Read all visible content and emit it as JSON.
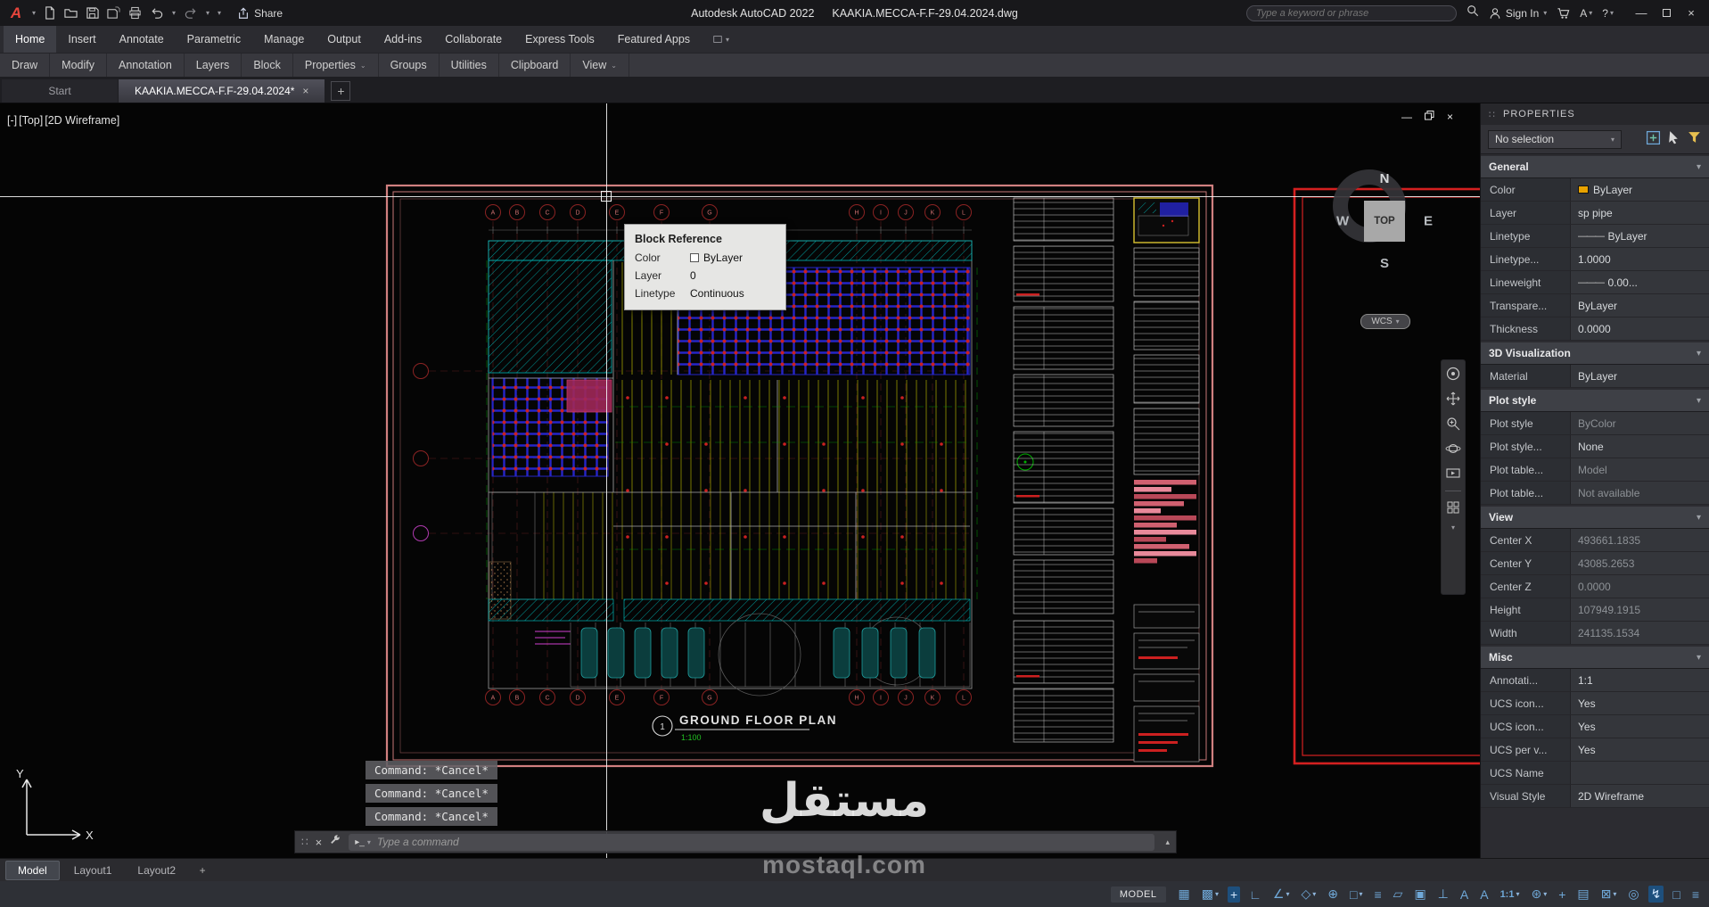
{
  "titlebar": {
    "app_name": "Autodesk AutoCAD 2022",
    "doc_name": "KAAKIA.MECCA-F.F-29.04.2024.dwg",
    "share": "Share",
    "search_placeholder": "Type a keyword or phrase",
    "sign_in": "Sign In",
    "help": "?",
    "alerts": "A"
  },
  "ribbon": {
    "tabs": [
      "Home",
      "Insert",
      "Annotate",
      "Parametric",
      "Manage",
      "Output",
      "Add-ins",
      "Collaborate",
      "Express Tools",
      "Featured Apps"
    ],
    "active_tab": "Home",
    "panels": [
      {
        "label": "Draw"
      },
      {
        "label": "Modify"
      },
      {
        "label": "Annotation"
      },
      {
        "label": "Layers"
      },
      {
        "label": "Block"
      },
      {
        "label": "Properties",
        "caret": true
      },
      {
        "label": "Groups"
      },
      {
        "label": "Utilities"
      },
      {
        "label": "Clipboard"
      },
      {
        "label": "View",
        "caret": true
      }
    ]
  },
  "file_tabs": {
    "tabs": [
      {
        "label": "Start",
        "active": false,
        "closable": false
      },
      {
        "label": "KAAKIA.MECCA-F.F-29.04.2024*",
        "active": true,
        "closable": true
      }
    ]
  },
  "viewport": {
    "controls": [
      "[-]",
      "[Top]",
      "[2D Wireframe]"
    ],
    "compass": {
      "n": "N",
      "s": "S",
      "e": "E",
      "w": "W",
      "center": "TOP",
      "ucs": "WCS"
    }
  },
  "tooltip": {
    "title": "Block Reference",
    "rows": [
      {
        "label": "Color",
        "value": "ByLayer",
        "swatch": true
      },
      {
        "label": "Layer",
        "value": "0"
      },
      {
        "label": "Linetype",
        "value": "Continuous"
      }
    ]
  },
  "command": {
    "history": [
      "Command: *Cancel*",
      "Command: *Cancel*",
      "Command: *Cancel*"
    ],
    "placeholder": "Type a command"
  },
  "drawing": {
    "title": "GROUND FLOOR PLAN",
    "scale": "1:100",
    "detail": "1",
    "grid_labels": [
      "A",
      "B",
      "C",
      "D",
      "E",
      "F",
      "G",
      "H",
      "I",
      "J",
      "K",
      "L"
    ]
  },
  "properties": {
    "title": "PROPERTIES",
    "selection": "No selection",
    "sections": [
      {
        "title": "General",
        "rows": [
          {
            "label": "Color",
            "value": "ByLayer",
            "swatch": "#e8a200"
          },
          {
            "label": "Layer",
            "value": "sp pipe"
          },
          {
            "label": "Linetype",
            "value": "ByLayer",
            "line": true
          },
          {
            "label": "Linetype...",
            "value": "1.0000"
          },
          {
            "label": "Lineweight",
            "value": "0.00...",
            "line": true
          },
          {
            "label": "Transpare...",
            "value": "ByLayer"
          },
          {
            "label": "Thickness",
            "value": "0.0000"
          }
        ]
      },
      {
        "title": "3D Visualization",
        "rows": [
          {
            "label": "Material",
            "value": "ByLayer"
          }
        ]
      },
      {
        "title": "Plot style",
        "rows": [
          {
            "label": "Plot style",
            "value": "ByColor",
            "dim": true
          },
          {
            "label": "Plot style...",
            "value": "None"
          },
          {
            "label": "Plot table...",
            "value": "Model",
            "dim": true
          },
          {
            "label": "Plot table...",
            "value": "Not available",
            "dim": true
          }
        ]
      },
      {
        "title": "View",
        "rows": [
          {
            "label": "Center X",
            "value": "493661.1835",
            "dim": true
          },
          {
            "label": "Center Y",
            "value": "43085.2653",
            "dim": true
          },
          {
            "label": "Center Z",
            "value": "0.0000",
            "dim": true
          },
          {
            "label": "Height",
            "value": "107949.1915",
            "dim": true
          },
          {
            "label": "Width",
            "value": "241135.1534",
            "dim": true
          }
        ]
      },
      {
        "title": "Misc",
        "rows": [
          {
            "label": "Annotati...",
            "value": "1:1"
          },
          {
            "label": "UCS icon...",
            "value": "Yes"
          },
          {
            "label": "UCS icon...",
            "value": "Yes"
          },
          {
            "label": "UCS per v...",
            "value": "Yes"
          },
          {
            "label": "UCS Name",
            "value": ""
          },
          {
            "label": "Visual Style",
            "value": "2D Wireframe"
          }
        ]
      }
    ]
  },
  "layout_tabs": {
    "tabs": [
      "Model",
      "Layout1",
      "Layout2"
    ],
    "active": "Model"
  },
  "statusbar": {
    "model": "MODEL",
    "icons": [
      {
        "name": "grid-display",
        "glyph": "▦"
      },
      {
        "name": "snap-mode",
        "glyph": "▩",
        "caret": true
      },
      {
        "name": "dynamic-input",
        "glyph": "+",
        "active": true
      },
      {
        "name": "ortho-mode",
        "glyph": "∟"
      },
      {
        "name": "polar-tracking",
        "glyph": "∠",
        "caret": true
      },
      {
        "name": "isometric-drafting",
        "glyph": "◇",
        "caret": true
      },
      {
        "name": "object-snap-tracking",
        "glyph": "⊕"
      },
      {
        "name": "object-snap",
        "glyph": "□",
        "caret": true
      },
      {
        "name": "lineweight",
        "glyph": "≡"
      },
      {
        "name": "transparency",
        "glyph": "▱"
      },
      {
        "name": "selection-cycling",
        "glyph": "▣"
      },
      {
        "name": "dynamic-ucs",
        "glyph": "⊥"
      },
      {
        "name": "annotation-visibility",
        "glyph": "A"
      },
      {
        "name": "autoscale",
        "glyph": "A"
      },
      {
        "name": "annotation-scale",
        "glyph": "1:1",
        "caret": true,
        "text": true
      },
      {
        "name": "workspace-switching",
        "glyph": "⊛",
        "caret": true
      },
      {
        "name": "annotation-monitor",
        "glyph": "+"
      },
      {
        "name": "quick-properties",
        "glyph": "▤"
      },
      {
        "name": "lock-ui",
        "glyph": "⊠",
        "caret": true
      },
      {
        "name": "isolate-objects",
        "glyph": "◎"
      },
      {
        "name": "graphics-performance",
        "glyph": "↯",
        "active": true
      },
      {
        "name": "clean-screen",
        "glyph": "□"
      },
      {
        "name": "customization",
        "glyph": "≡"
      }
    ]
  },
  "watermark": {
    "arabic": "مستقل",
    "latin": "mostaql.com"
  },
  "colors": {
    "accent_blue": "#6fa8d8",
    "layer_yellow": "#e8a200",
    "frame_pink": "#d08080",
    "frame_red": "#d42020"
  }
}
